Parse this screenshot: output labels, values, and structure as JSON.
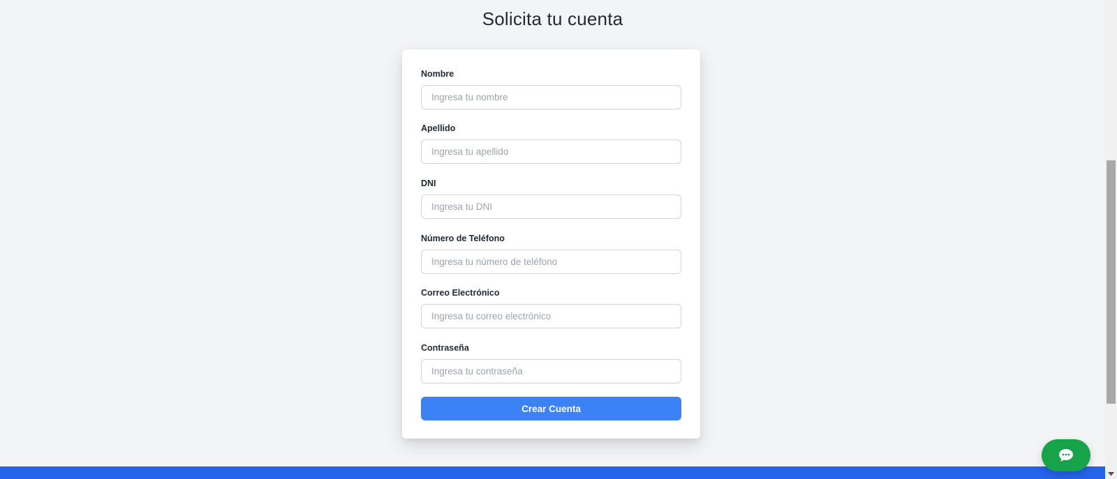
{
  "page": {
    "title": "Solicita tu cuenta"
  },
  "form": {
    "fields": [
      {
        "label": "Nombre",
        "placeholder": "Ingresa tu nombre",
        "value": ""
      },
      {
        "label": "Apellido",
        "placeholder": "Ingresa tu apellido",
        "value": ""
      },
      {
        "label": "DNI",
        "placeholder": "Ingresa tu DNI",
        "value": ""
      },
      {
        "label": "Número de Teléfono",
        "placeholder": "Ingresa tu número de teléfono",
        "value": ""
      },
      {
        "label": "Correo Electrónico",
        "placeholder": "Ingresa tu correo electrónico",
        "value": ""
      },
      {
        "label": "Contraseña",
        "placeholder": "Ingresa tu contraseña",
        "value": ""
      }
    ],
    "submit_label": "Crear Cuenta"
  },
  "chat": {
    "icon": "chat-bubble-icon",
    "color": "#16a34a"
  },
  "colors": {
    "background": "#f3f4f6",
    "primary_button": "#3b82f6",
    "footer": "#2563eb"
  }
}
